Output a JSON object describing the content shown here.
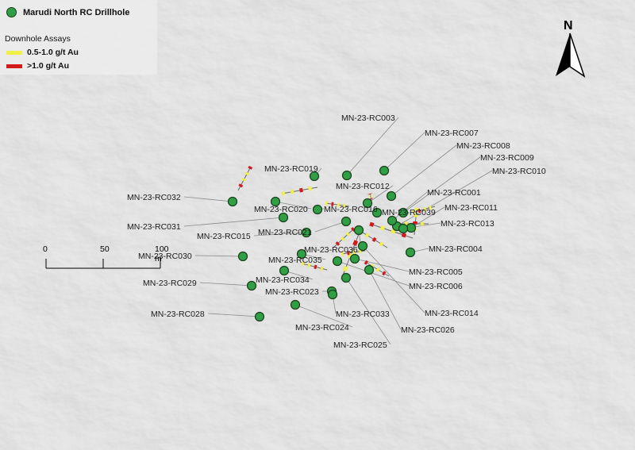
{
  "legend": {
    "drillhole_label": "Marudi North RC Drillhole",
    "assays_title": "Downhole Assays",
    "low_label": "0.5-1.0 g/t Au",
    "high_label": ">1.0 g/t Au",
    "colors": {
      "drillhole": "#2f9e44",
      "low": "#f0f04a",
      "high": "#d11a1a"
    }
  },
  "north_arrow": {
    "label": "N"
  },
  "scale_bar": {
    "ticks": [
      "0",
      "50",
      "100 m"
    ]
  },
  "drillholes": [
    "MN-23-RC003",
    "MN-23-RC007",
    "MN-23-RC008",
    "MN-23-RC009",
    "MN-23-RC010",
    "MN-23-RC019",
    "MN-23-RC012",
    "MN-23-RC001",
    "MN-23-RC032",
    "MN-23-RC020",
    "MN-23-RC016",
    "MN-23-RC039",
    "MN-23-RC011",
    "MN-23-RC031",
    "MN-23-RC021",
    "MN-23-RC013",
    "MN-23-RC015",
    "MN-23-RC036",
    "MN-23-RC004",
    "MN-23-RC030",
    "MN-23-RC035",
    "MN-23-RC005",
    "MN-23-RC029",
    "MN-23-RC034",
    "MN-23-RC006",
    "MN-23-RC023",
    "MN-23-RC028",
    "MN-23-RC033",
    "MN-23-RC014",
    "MN-23-RC024",
    "MN-23-RC026",
    "MN-23-RC025"
  ]
}
